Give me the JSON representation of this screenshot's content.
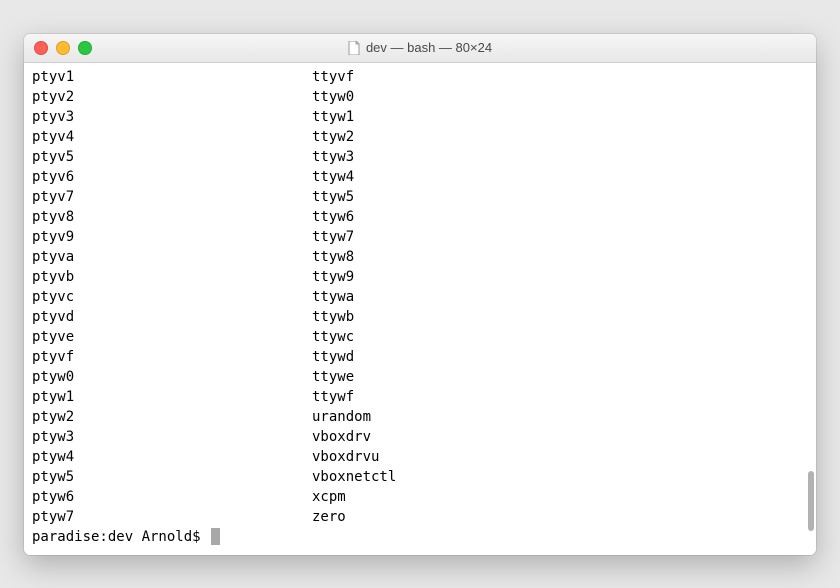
{
  "window": {
    "title": "dev — bash — 80×24"
  },
  "terminal": {
    "rows": [
      {
        "c1": "ptyv1",
        "c2": "ttyvf"
      },
      {
        "c1": "ptyv2",
        "c2": "ttyw0"
      },
      {
        "c1": "ptyv3",
        "c2": "ttyw1"
      },
      {
        "c1": "ptyv4",
        "c2": "ttyw2"
      },
      {
        "c1": "ptyv5",
        "c2": "ttyw3"
      },
      {
        "c1": "ptyv6",
        "c2": "ttyw4"
      },
      {
        "c1": "ptyv7",
        "c2": "ttyw5"
      },
      {
        "c1": "ptyv8",
        "c2": "ttyw6"
      },
      {
        "c1": "ptyv9",
        "c2": "ttyw7"
      },
      {
        "c1": "ptyva",
        "c2": "ttyw8"
      },
      {
        "c1": "ptyvb",
        "c2": "ttyw9"
      },
      {
        "c1": "ptyvc",
        "c2": "ttywa"
      },
      {
        "c1": "ptyvd",
        "c2": "ttywb"
      },
      {
        "c1": "ptyve",
        "c2": "ttywc"
      },
      {
        "c1": "ptyvf",
        "c2": "ttywd"
      },
      {
        "c1": "ptyw0",
        "c2": "ttywe"
      },
      {
        "c1": "ptyw1",
        "c2": "ttywf"
      },
      {
        "c1": "ptyw2",
        "c2": "urandom"
      },
      {
        "c1": "ptyw3",
        "c2": "vboxdrv"
      },
      {
        "c1": "ptyw4",
        "c2": "vboxdrvu"
      },
      {
        "c1": "ptyw5",
        "c2": "vboxnetctl"
      },
      {
        "c1": "ptyw6",
        "c2": "xcpm"
      },
      {
        "c1": "ptyw7",
        "c2": "zero"
      }
    ],
    "prompt": "paradise:dev Arnold$ "
  }
}
